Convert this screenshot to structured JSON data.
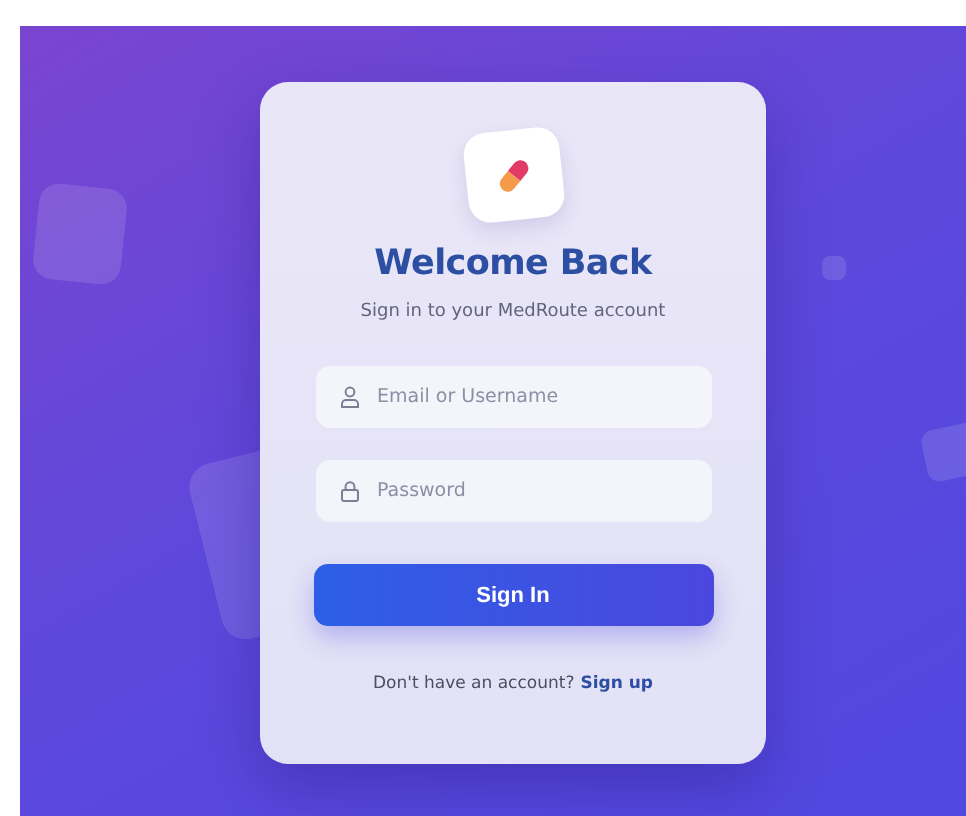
{
  "card": {
    "title": "Welcome Back",
    "subtitle": "Sign in to your MedRoute account"
  },
  "fields": [
    {
      "kind": "user",
      "placeholder": "Email or Username"
    },
    {
      "kind": "lock",
      "placeholder": "Password"
    }
  ],
  "submit": "Sign In",
  "footer": {
    "text": "Don't have an account?",
    "link": "Sign up"
  }
}
